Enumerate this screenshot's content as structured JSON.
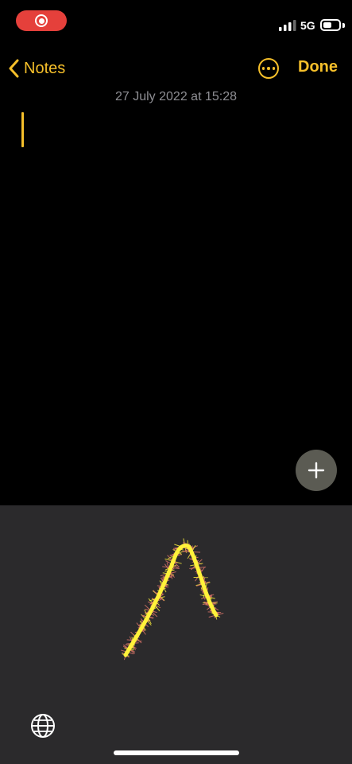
{
  "status_bar": {
    "network": "5G",
    "battery_level": 0.55,
    "recording_color": "#e5403b"
  },
  "nav": {
    "back_label": "Notes",
    "done_label": "Done",
    "accent_color": "#f5bf2a",
    "icons": [
      "chevron-left-icon",
      "ellipsis-circle-icon"
    ]
  },
  "note": {
    "date": "27 July 2022 at 15:28",
    "body": ""
  },
  "fab": {
    "icon": "plus-icon"
  },
  "keyboard": {
    "mode": "handwriting",
    "icon": "globe-icon",
    "ink_color": "#fff23a",
    "sparkle_color": "#e0776b"
  }
}
